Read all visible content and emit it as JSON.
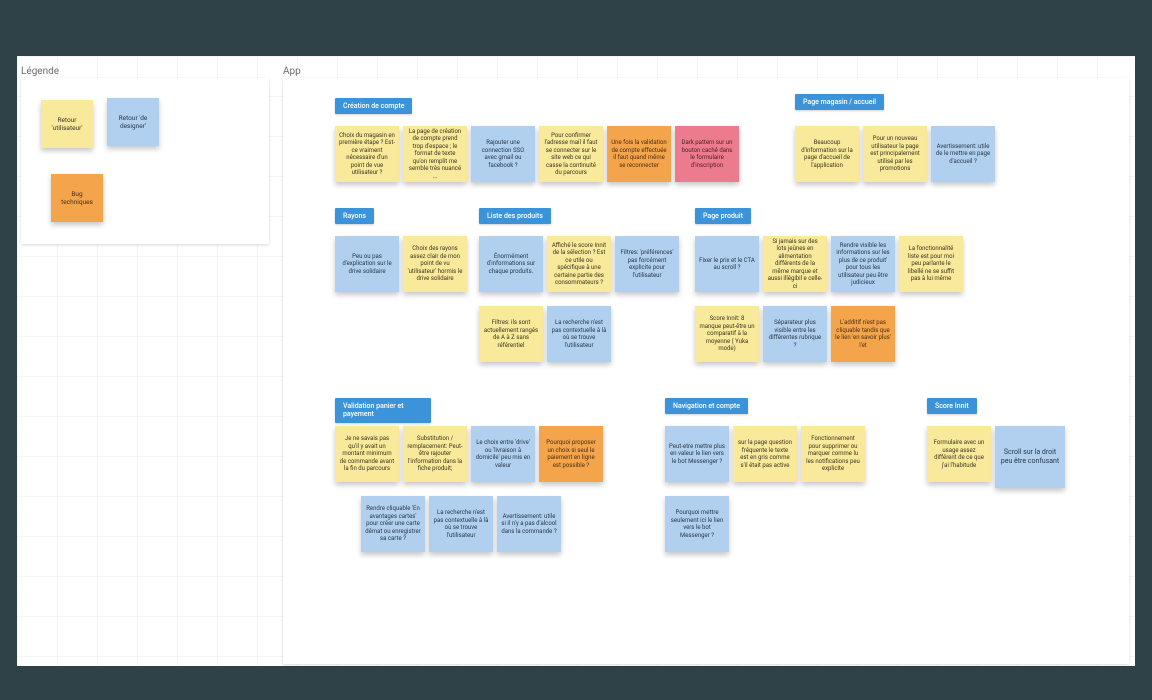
{
  "sections": {
    "legend": "Légende",
    "app": "App"
  },
  "legend_notes": {
    "user": "Retour 'utilisateur'",
    "designer": "Retour 'de designer'",
    "bug": "Bug techniques"
  },
  "tags": {
    "creation": "Création de compte",
    "magasin": "Page magasin / accueil",
    "rayons": "Rayons",
    "liste": "Liste des produits",
    "produit": "Page produit",
    "validation": "Validation panier et payement",
    "navigation": "Navigation et compte",
    "score": "Score Innit"
  },
  "notes": {
    "c1": "Choix du magasin en première étape ? Est-ce vraiment nécessaire d'un point de vue utilisateur ?",
    "c2": "La page de création de compte prend trop d'espace ; le format de texte qu'on remplit me semble très nuancé …",
    "c3": "Rajouter une connection SSO avec gmail ou facebook ?",
    "c4": "Pour confirmer l'adresse mail il faut se connecter sur le site web ce qui casse la continuité du parcours",
    "c5": "Une fois la validation de compte effectuée il faut quand même se reconnecter",
    "c6": "Dark pattern sur un bouton caché dans le formulaire d'inscription",
    "m1": "Beaucoup d'information sur la page d'accueil de l'application",
    "m2": "Pour un nouveau utilisateur la page est principalement utilisé par les promotions",
    "m3": "Avertissement: utile de le mettre en page d'accueil ?",
    "r1": "Peu ou pas d'explication sur le drive solidaire",
    "r2": "Choix des rayons assez clair de mon point de vu 'utilisateur' hormis le drive solidaire",
    "l1": "Énormément d'informations sur chaque produits.",
    "l2": "Affiché le score Innit de la sélection ? Est ce utile ou spécifique à une certaine partie des consommateurs ?",
    "l3": "Filtres: 'préférences' pas forcément explicite pour l'utilisateur",
    "l4": "Filtres: ils sont actuellement rangés de A à Z sans référentiel",
    "l5": "La recherche n'est pas contextuelle à là où se trouve l'utilisateur",
    "p1": "Fixer le prix et le CTA au scroll ?",
    "p2": "Si jamais sur des lots jeûnes en alimentation différents de la même marque et aussi illégibil e celle-ci",
    "p3": "Rendre visible les informations sur les plus de ce produit' pour tous les utilisateur peu être judicieux",
    "p4": "La fonctionnalité liste est pour moi peu parlante le libellé ne se suffit pas à lui même",
    "p5": "Score Innit: 8 manque peut-être un comparatif à la moyenne ( Yuka mode)",
    "p6": "Séparateur plus visible entre les différentes rubrique ?",
    "p7": "L'additif n'est pas cliquable tandis que le lien 'en savoir plus' l'et",
    "v1": "Je ne savais pas qu'il y avait un montant minimum de commande avant la fin du parcours",
    "v2": "Substitution / remplacement: Peut-être rajouter l'information dans la fiche produit;",
    "v3": "Le choix entre 'drive' ou 'livraison à domicile' peu mis en valeur",
    "v4": "Pourquoi proposer un choix si seul le paiement en ligne est possible ?",
    "v5": "Rendre cliquable 'En avantages cartes' pour créer une carte démat ou enregistrer sa carte ?",
    "v6": "La recherche n'est pas contextuelle à là où se trouve l'utilisateur",
    "v7": "Avertissement: utile si il n'y a pas d'alcool dans la commande ?",
    "n1": "Peut-etre mettre plus en valeur le lien vers le bot Messenger ?",
    "n2": "sur la page question fréquente le texte est en gris comme s'il était pas active",
    "n3": "Fonctionnement pour supprimer ou marquer comme lu les notifications peu explicite",
    "n4": "Pourquoi mettre seulement ici le lien vers le bot Messenger ?",
    "s1": "Formulaire avec un usage assez différent de ce que j'ai l'habitude",
    "s2": "Scroll sur la droit peu être confusant"
  }
}
